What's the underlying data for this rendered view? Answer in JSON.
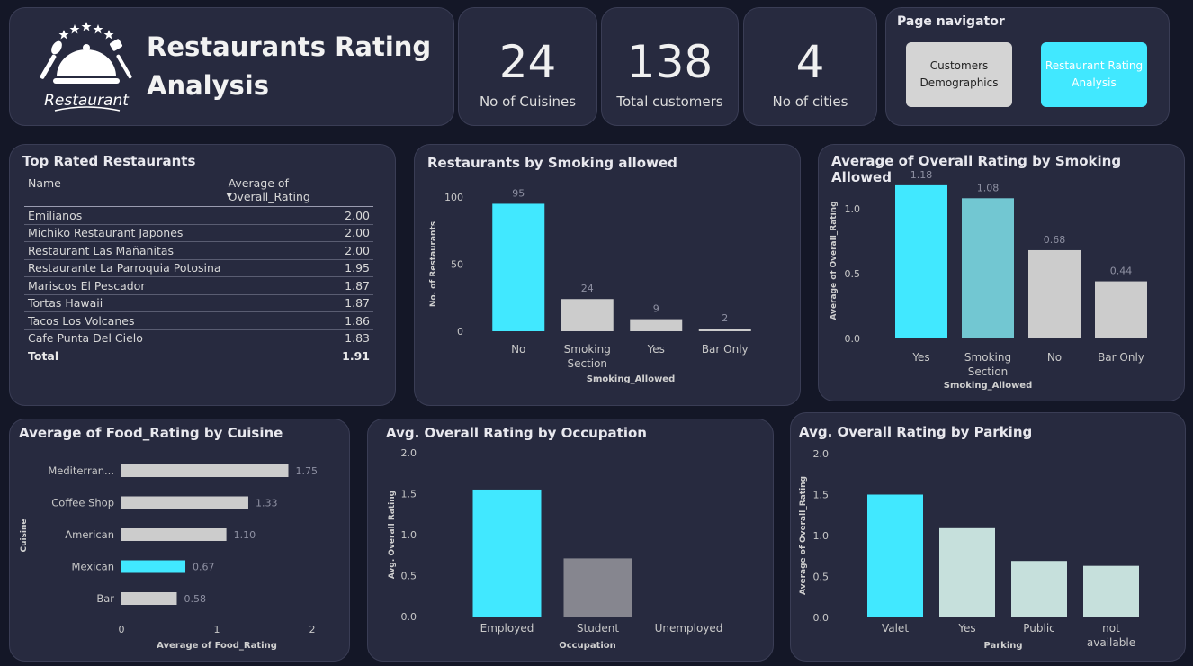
{
  "header": {
    "logo_text": "Restaurant",
    "title": "Restaurants Rating Analysis"
  },
  "kpis": [
    {
      "value": "24",
      "label": "No of Cuisines"
    },
    {
      "value": "138",
      "label": "Total customers"
    },
    {
      "value": "4",
      "label": "No of cities"
    }
  ],
  "navigator": {
    "title": "Page navigator",
    "buttons": [
      {
        "label": "Customers Demographics",
        "color": "#d4d4d4",
        "text_color": "#222222"
      },
      {
        "label": "Restaurant Rating Analysis",
        "color": "#41e8ff",
        "text_color": "#ffffff"
      }
    ]
  },
  "top_table": {
    "title": "Top Rated Restaurants",
    "columns": [
      "Name",
      "Average of Overall_Rating"
    ],
    "rows": [
      [
        "Emilianos",
        "2.00"
      ],
      [
        "Michiko Restaurant Japones",
        "2.00"
      ],
      [
        "Restaurant Las Mañanitas",
        "2.00"
      ],
      [
        "Restaurante La Parroquia Potosina",
        "1.95"
      ],
      [
        "Mariscos El Pescador",
        "1.87"
      ],
      [
        "Tortas Hawaii",
        "1.87"
      ],
      [
        "Tacos Los Volcanes",
        "1.86"
      ],
      [
        "Cafe Punta Del Cielo",
        "1.83"
      ]
    ],
    "total_label": "Total",
    "total_value": "1.91"
  },
  "colors": {
    "accent": "#41e8ff",
    "grey": "#cccccc",
    "teal": "#72c7d2",
    "dark_grey": "#86868f",
    "pale": "#c6e0dc"
  },
  "chart_data": [
    {
      "id": "smoking",
      "type": "bar",
      "title": "Restaurants by Smoking allowed",
      "xlabel": "Smoking_Allowed",
      "ylabel": "No. of Restaurants",
      "categories": [
        "No",
        "Smoking Section",
        "Yes",
        "Bar Only"
      ],
      "values": [
        95,
        24,
        9,
        2
      ],
      "labels": [
        "95",
        "24",
        "9",
        "2"
      ],
      "ticks": [
        0,
        50,
        100
      ],
      "ylim": [
        0,
        100
      ],
      "colors": [
        "#41e8ff",
        "#cccccc",
        "#cccccc",
        "#cccccc"
      ]
    },
    {
      "id": "avgsmoke",
      "type": "bar",
      "title": "Average of Overall Rating by Smoking Allowed",
      "xlabel": "Smoking_Allowed",
      "ylabel": "Average of Overall_Rating",
      "categories": [
        "Yes",
        "Smoking Section",
        "No",
        "Bar Only"
      ],
      "values": [
        1.18,
        1.08,
        0.68,
        0.44
      ],
      "labels": [
        "1.18",
        "1.08",
        "0.68",
        "0.44"
      ],
      "ticks": [
        0.0,
        0.5,
        1.0
      ],
      "tick_labels": [
        "0.0",
        "0.5",
        "1.0"
      ],
      "ylim": [
        0,
        1.2
      ],
      "colors": [
        "#41e8ff",
        "#72c7d2",
        "#cccccc",
        "#cccccc"
      ]
    },
    {
      "id": "food",
      "type": "bar",
      "orientation": "horizontal",
      "title": "Average of Food_Rating by Cuisine",
      "xlabel": "Average of Food_Rating",
      "ylabel": "Cuisine",
      "categories": [
        "Mediterran...",
        "Coffee Shop",
        "American",
        "Mexican",
        "Bar"
      ],
      "values": [
        1.75,
        1.33,
        1.1,
        0.67,
        0.58
      ],
      "labels": [
        "1.75",
        "1.33",
        "1.10",
        "0.67",
        "0.58"
      ],
      "ticks": [
        0,
        1,
        2
      ],
      "xlim": [
        0,
        2
      ],
      "colors": [
        "#cccccc",
        "#cccccc",
        "#cccccc",
        "#41e8ff",
        "#cccccc"
      ]
    },
    {
      "id": "occupation",
      "type": "bar",
      "title": "Avg. Overall Rating by Occupation",
      "xlabel": "Occupation",
      "ylabel": "Avg. Overall Rating",
      "categories": [
        "Employed",
        "Student",
        "Unemployed"
      ],
      "values": [
        1.55,
        0.71,
        0
      ],
      "ticks": [
        0.0,
        0.5,
        1.0,
        1.5,
        2.0
      ],
      "tick_labels": [
        "0.0",
        "0.5",
        "1.0",
        "1.5",
        "2.0"
      ],
      "ylim": [
        0,
        2.0
      ],
      "colors": [
        "#41e8ff",
        "#86868f",
        "#86868f"
      ]
    },
    {
      "id": "parking",
      "type": "bar",
      "title": "Avg. Overall Rating by Parking",
      "xlabel": "Parking",
      "ylabel": "Average of Overall_Rating",
      "categories": [
        "Valet",
        "Yes",
        "Public",
        "not available"
      ],
      "values": [
        1.5,
        1.09,
        0.69,
        0.63
      ],
      "ticks": [
        0.0,
        0.5,
        1.0,
        1.5,
        2.0
      ],
      "tick_labels": [
        "0.0",
        "0.5",
        "1.0",
        "1.5",
        "2.0"
      ],
      "ylim": [
        0,
        2.0
      ],
      "colors": [
        "#41e8ff",
        "#c6e0dc",
        "#c6e0dc",
        "#c6e0dc"
      ]
    }
  ]
}
